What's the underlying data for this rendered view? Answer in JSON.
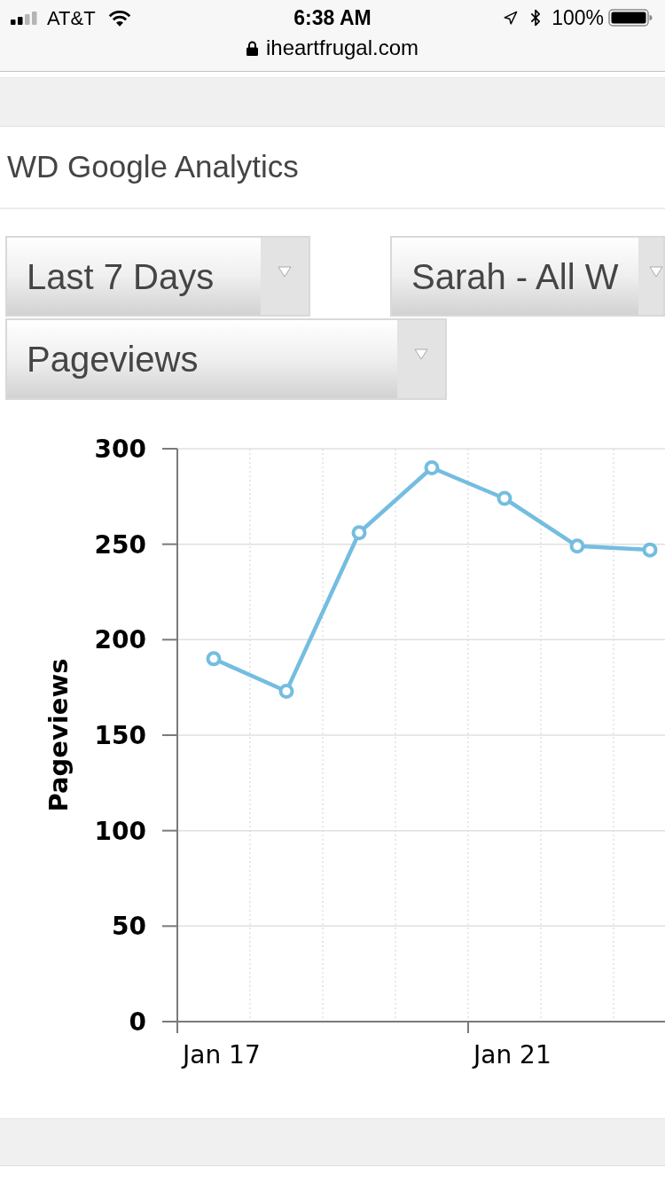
{
  "status_bar": {
    "carrier": "AT&T",
    "time": "6:38 AM",
    "battery": "100%"
  },
  "address_bar": {
    "url": "iheartfrugal.com"
  },
  "widget": {
    "title": "WD Google Analytics",
    "dropdowns": [
      {
        "value": "Last 7 Days"
      },
      {
        "value": "Sarah - All W"
      },
      {
        "value": "Pageviews"
      }
    ],
    "chart": {
      "chart_data": {
        "type": "line",
        "ylabel": "Pageviews",
        "categories": [
          "Jan 17",
          null,
          null,
          null,
          "Jan 21",
          null,
          null
        ],
        "values": [
          190,
          173,
          256,
          290,
          274,
          249,
          247
        ],
        "ylim": [
          0,
          300
        ],
        "yticks": [
          0,
          50,
          100,
          150,
          200,
          250,
          300
        ],
        "grid": true,
        "marker": true
      }
    }
  }
}
